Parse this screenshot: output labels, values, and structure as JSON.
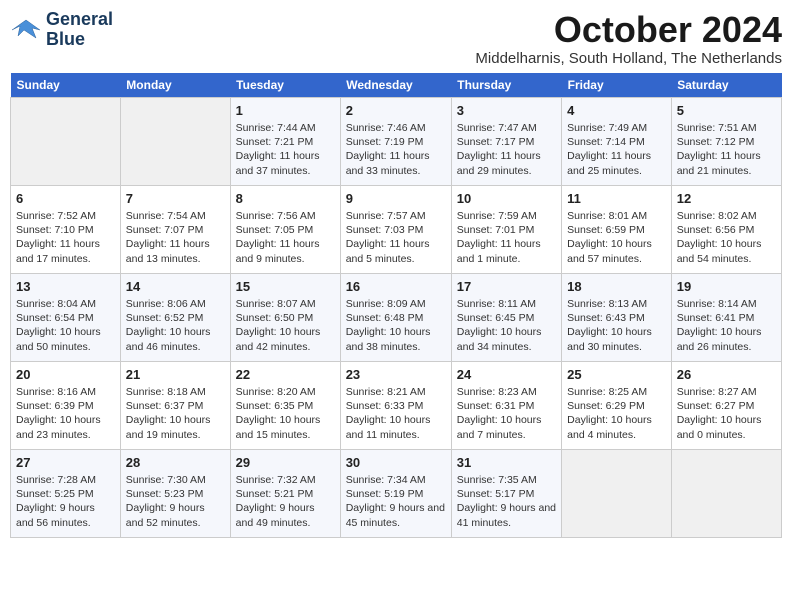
{
  "logo": {
    "line1": "General",
    "line2": "Blue"
  },
  "title": "October 2024",
  "subtitle": "Middelharnis, South Holland, The Netherlands",
  "weekdays": [
    "Sunday",
    "Monday",
    "Tuesday",
    "Wednesday",
    "Thursday",
    "Friday",
    "Saturday"
  ],
  "weeks": [
    [
      {
        "day": "",
        "content": ""
      },
      {
        "day": "",
        "content": ""
      },
      {
        "day": "1",
        "content": "Sunrise: 7:44 AM\nSunset: 7:21 PM\nDaylight: 11 hours and 37 minutes."
      },
      {
        "day": "2",
        "content": "Sunrise: 7:46 AM\nSunset: 7:19 PM\nDaylight: 11 hours and 33 minutes."
      },
      {
        "day": "3",
        "content": "Sunrise: 7:47 AM\nSunset: 7:17 PM\nDaylight: 11 hours and 29 minutes."
      },
      {
        "day": "4",
        "content": "Sunrise: 7:49 AM\nSunset: 7:14 PM\nDaylight: 11 hours and 25 minutes."
      },
      {
        "day": "5",
        "content": "Sunrise: 7:51 AM\nSunset: 7:12 PM\nDaylight: 11 hours and 21 minutes."
      }
    ],
    [
      {
        "day": "6",
        "content": "Sunrise: 7:52 AM\nSunset: 7:10 PM\nDaylight: 11 hours and 17 minutes."
      },
      {
        "day": "7",
        "content": "Sunrise: 7:54 AM\nSunset: 7:07 PM\nDaylight: 11 hours and 13 minutes."
      },
      {
        "day": "8",
        "content": "Sunrise: 7:56 AM\nSunset: 7:05 PM\nDaylight: 11 hours and 9 minutes."
      },
      {
        "day": "9",
        "content": "Sunrise: 7:57 AM\nSunset: 7:03 PM\nDaylight: 11 hours and 5 minutes."
      },
      {
        "day": "10",
        "content": "Sunrise: 7:59 AM\nSunset: 7:01 PM\nDaylight: 11 hours and 1 minute."
      },
      {
        "day": "11",
        "content": "Sunrise: 8:01 AM\nSunset: 6:59 PM\nDaylight: 10 hours and 57 minutes."
      },
      {
        "day": "12",
        "content": "Sunrise: 8:02 AM\nSunset: 6:56 PM\nDaylight: 10 hours and 54 minutes."
      }
    ],
    [
      {
        "day": "13",
        "content": "Sunrise: 8:04 AM\nSunset: 6:54 PM\nDaylight: 10 hours and 50 minutes."
      },
      {
        "day": "14",
        "content": "Sunrise: 8:06 AM\nSunset: 6:52 PM\nDaylight: 10 hours and 46 minutes."
      },
      {
        "day": "15",
        "content": "Sunrise: 8:07 AM\nSunset: 6:50 PM\nDaylight: 10 hours and 42 minutes."
      },
      {
        "day": "16",
        "content": "Sunrise: 8:09 AM\nSunset: 6:48 PM\nDaylight: 10 hours and 38 minutes."
      },
      {
        "day": "17",
        "content": "Sunrise: 8:11 AM\nSunset: 6:45 PM\nDaylight: 10 hours and 34 minutes."
      },
      {
        "day": "18",
        "content": "Sunrise: 8:13 AM\nSunset: 6:43 PM\nDaylight: 10 hours and 30 minutes."
      },
      {
        "day": "19",
        "content": "Sunrise: 8:14 AM\nSunset: 6:41 PM\nDaylight: 10 hours and 26 minutes."
      }
    ],
    [
      {
        "day": "20",
        "content": "Sunrise: 8:16 AM\nSunset: 6:39 PM\nDaylight: 10 hours and 23 minutes."
      },
      {
        "day": "21",
        "content": "Sunrise: 8:18 AM\nSunset: 6:37 PM\nDaylight: 10 hours and 19 minutes."
      },
      {
        "day": "22",
        "content": "Sunrise: 8:20 AM\nSunset: 6:35 PM\nDaylight: 10 hours and 15 minutes."
      },
      {
        "day": "23",
        "content": "Sunrise: 8:21 AM\nSunset: 6:33 PM\nDaylight: 10 hours and 11 minutes."
      },
      {
        "day": "24",
        "content": "Sunrise: 8:23 AM\nSunset: 6:31 PM\nDaylight: 10 hours and 7 minutes."
      },
      {
        "day": "25",
        "content": "Sunrise: 8:25 AM\nSunset: 6:29 PM\nDaylight: 10 hours and 4 minutes."
      },
      {
        "day": "26",
        "content": "Sunrise: 8:27 AM\nSunset: 6:27 PM\nDaylight: 10 hours and 0 minutes."
      }
    ],
    [
      {
        "day": "27",
        "content": "Sunrise: 7:28 AM\nSunset: 5:25 PM\nDaylight: 9 hours and 56 minutes."
      },
      {
        "day": "28",
        "content": "Sunrise: 7:30 AM\nSunset: 5:23 PM\nDaylight: 9 hours and 52 minutes."
      },
      {
        "day": "29",
        "content": "Sunrise: 7:32 AM\nSunset: 5:21 PM\nDaylight: 9 hours and 49 minutes."
      },
      {
        "day": "30",
        "content": "Sunrise: 7:34 AM\nSunset: 5:19 PM\nDaylight: 9 hours and 45 minutes."
      },
      {
        "day": "31",
        "content": "Sunrise: 7:35 AM\nSunset: 5:17 PM\nDaylight: 9 hours and 41 minutes."
      },
      {
        "day": "",
        "content": ""
      },
      {
        "day": "",
        "content": ""
      }
    ]
  ]
}
